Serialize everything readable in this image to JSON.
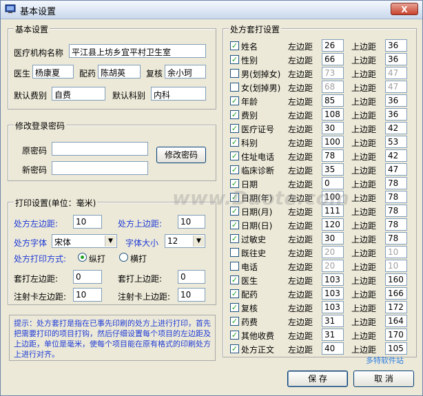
{
  "window": {
    "title": "基本设置",
    "close_label": "X"
  },
  "basic": {
    "legend": "基本设置",
    "org_label": "医疗机构名称",
    "org_value": "平江县上坊乡宜平村卫生室",
    "doctor_label": "医生",
    "doctor_value": "杨康夏",
    "dispense_label": "配药",
    "dispense_value": "陈胡英",
    "review_label": "复核",
    "review_value": "余小珂",
    "default_fee_label": "默认费别",
    "default_fee_value": "自费",
    "default_dept_label": "默认科别",
    "default_dept_value": "内科"
  },
  "password": {
    "legend": "修改登录密码",
    "old_label": "原密码",
    "old_value": "",
    "new_label": "新密码",
    "new_value": "",
    "change_button": "修改密码"
  },
  "print": {
    "legend": "打印设置(单位：毫米)",
    "left_margin_label": "处方左边距:",
    "left_margin_value": "10",
    "top_margin_label": "处方上边距:",
    "top_margin_value": "10",
    "font_label": "处方字体",
    "font_value": "宋体",
    "font_size_label": "字体大小",
    "font_size_value": "12",
    "mode_label": "处方打印方式:",
    "mode_portrait": "纵打",
    "mode_landscape": "横打",
    "mode_selected": "纵打",
    "overlay_left_label": "套打左边距:",
    "overlay_left_value": "0",
    "overlay_top_label": "套打上边距:",
    "overlay_top_value": "0",
    "inject_left_label": "注射卡左边距:",
    "inject_left_value": "10",
    "inject_top_label": "注射卡上边距:",
    "inject_top_value": "10"
  },
  "hint": "提示：处方套打是指在已事先印刷的处方上进行打印，首先把需要打印的项目打钩，然后仔细设置每个项目的左边距及上边距，单位是毫米，使每个项目能在原有格式的印刷处方上进行对齐。",
  "overlay": {
    "legend": "处方套打设置",
    "left_label": "左边距",
    "top_label": "上边距",
    "items": [
      {
        "label": "姓名",
        "checked": true,
        "left": "26",
        "top": "36"
      },
      {
        "label": "性别",
        "checked": true,
        "left": "66",
        "top": "36"
      },
      {
        "label": "男(划掉女)",
        "checked": false,
        "left": "73",
        "top": "47"
      },
      {
        "label": "女(划掉男)",
        "checked": false,
        "left": "68",
        "top": "47"
      },
      {
        "label": "年龄",
        "checked": true,
        "left": "85",
        "top": "36"
      },
      {
        "label": "费别",
        "checked": true,
        "left": "108",
        "top": "36"
      },
      {
        "label": "医疗证号",
        "checked": true,
        "left": "30",
        "top": "42"
      },
      {
        "label": "科别",
        "checked": true,
        "left": "100",
        "top": "53"
      },
      {
        "label": "住址电话",
        "checked": true,
        "left": "78",
        "top": "42"
      },
      {
        "label": "临床诊断",
        "checked": true,
        "left": "35",
        "top": "47"
      },
      {
        "label": "日期",
        "checked": true,
        "left": "0",
        "top": "78"
      },
      {
        "label": "日期(年)",
        "checked": true,
        "left": "100",
        "top": "78"
      },
      {
        "label": "日期(月)",
        "checked": true,
        "left": "111",
        "top": "78"
      },
      {
        "label": "日期(日)",
        "checked": true,
        "left": "120",
        "top": "78"
      },
      {
        "label": "过敏史",
        "checked": true,
        "left": "30",
        "top": "78"
      },
      {
        "label": "既往史",
        "checked": false,
        "left": "20",
        "top": "10"
      },
      {
        "label": "电话",
        "checked": false,
        "left": "20",
        "top": "10"
      },
      {
        "label": "医生",
        "checked": true,
        "left": "103",
        "top": "160"
      },
      {
        "label": "配药",
        "checked": true,
        "left": "103",
        "top": "166"
      },
      {
        "label": "复核",
        "checked": true,
        "left": "103",
        "top": "172"
      },
      {
        "label": "药费",
        "checked": true,
        "left": "31",
        "top": "164"
      },
      {
        "label": "其他收费",
        "checked": true,
        "left": "31",
        "top": "170"
      },
      {
        "label": "处方正文",
        "checked": true,
        "left": "40",
        "top": "105"
      }
    ]
  },
  "buttons": {
    "save": "保 存",
    "cancel": "取 消"
  },
  "watermark": "www.Duote.com",
  "logo_text": "多特软件站"
}
